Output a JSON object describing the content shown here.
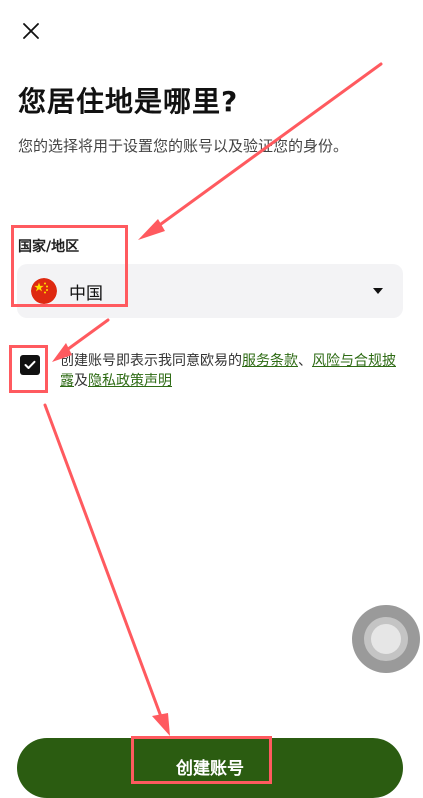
{
  "page": {
    "title": "您居住地是哪里?",
    "subtitle": "您的选择将用于设置您的账号以及验证您的身份。"
  },
  "region": {
    "label": "国家/地区",
    "selected_value": "中国",
    "flag_icon": "china-flag-icon"
  },
  "agreement": {
    "checked": true,
    "prefix": "创建账号即表示我同意欧易的",
    "link_terms": "服务条款",
    "separator": "、",
    "link_risk": "风险与合规披露",
    "conjunction": "及",
    "link_privacy": "隐私政策声明"
  },
  "actions": {
    "create_account_label": "创建账号"
  },
  "icons": {
    "close": "close-icon",
    "dropdown": "caret-down-icon",
    "check": "check-icon",
    "assistive": "assistive-touch-icon"
  },
  "colors": {
    "primary": "#2b5c11",
    "link": "#2e6b14",
    "annotation": "#ff5a5f",
    "select_bg": "#f3f3f5"
  }
}
